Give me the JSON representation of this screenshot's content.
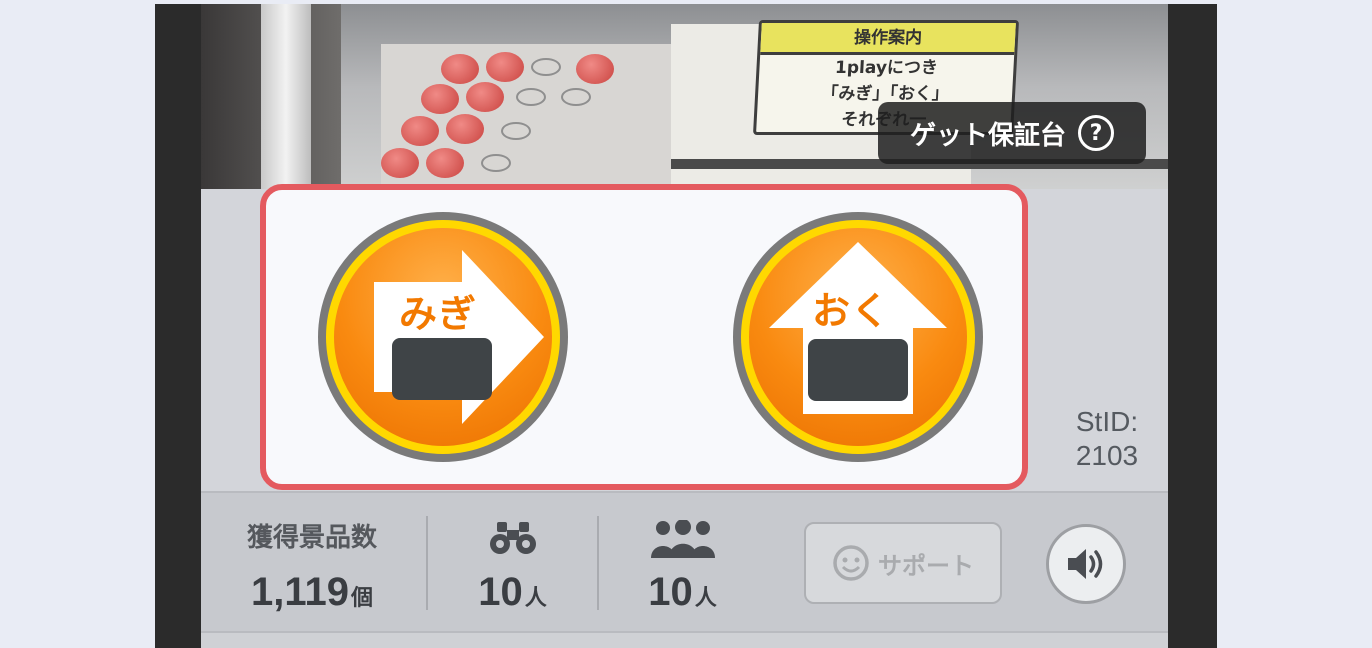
{
  "camera": {
    "guide_title": "操作案内",
    "guide_line1": "1playにつき",
    "guide_line2": "「みぎ」「おく」",
    "guide_line3": "それぞれ一",
    "get_guarantee_label": "ゲット保証台",
    "help_icon_glyph": "?"
  },
  "controls": {
    "right_button_label": "みぎ",
    "back_button_label": "おく",
    "accent_color": "#f98a10",
    "highlight_color": "#e45a5f"
  },
  "station": {
    "id_label": "StID:",
    "id_value": "2103"
  },
  "stats": {
    "prizes_label": "獲得景品数",
    "prizes_value": "1,119",
    "prizes_unit": "個",
    "watchers_value": "10",
    "watchers_unit": "人",
    "players_value": "10",
    "players_unit": "人"
  },
  "support": {
    "label": "サポート"
  }
}
